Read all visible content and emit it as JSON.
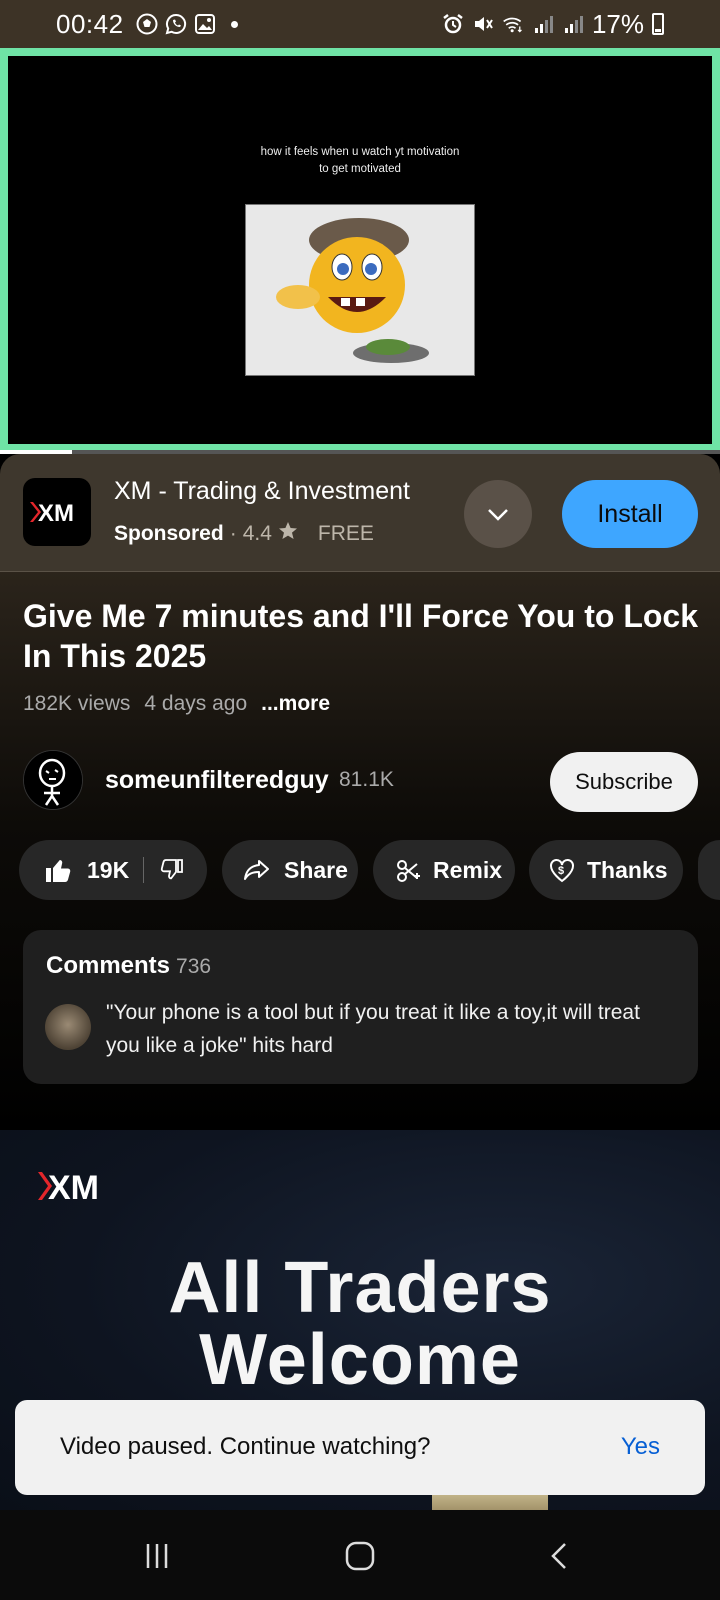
{
  "status_bar": {
    "time": "00:42",
    "battery_text": "17%",
    "icons_left": [
      "soccer-icon",
      "whatsapp-icon",
      "gallery-icon",
      "dot-icon"
    ],
    "icons_right": [
      "alarm-icon",
      "mute-icon",
      "wifi-icon",
      "signal-icon",
      "signal-icon",
      "battery-icon"
    ]
  },
  "video": {
    "caption": "how it feels when u watch yt motivation\nto get motivated",
    "progress_fraction": 0.1
  },
  "ad": {
    "app_name": "XM - Trading & Investment",
    "sponsored": "Sponsored",
    "separator": "·",
    "rating": "4.4",
    "price": "FREE",
    "install_label": "Install",
    "logo_text": "XM"
  },
  "video_info": {
    "title": "Give Me 7 minutes and I'll Force You to Lock In This 2025",
    "views": "182K views",
    "age": "4 days ago",
    "more": "...more"
  },
  "channel": {
    "name": "someunfilteredguy",
    "subscribers": "81.1K",
    "subscribe_label": "Subscribe"
  },
  "actions": {
    "likes": "19K",
    "share": "Share",
    "remix": "Remix",
    "thanks": "Thanks"
  },
  "comments": {
    "header": "Comments",
    "count": "736",
    "top_comment": "\"Your phone is a tool but if you treat it like a toy,it will treat you like a joke\" hits hard"
  },
  "ad_banner": {
    "logo_text": "XM",
    "headline": "All Traders\nWelcome"
  },
  "snackbar": {
    "message": "Video paused. Continue watching?",
    "action": "Yes"
  },
  "colors": {
    "accent_green_border": "#6fe3a6",
    "install_blue": "#3ea6ff",
    "link_blue": "#065fd4",
    "xm_red": "#e4262b"
  }
}
